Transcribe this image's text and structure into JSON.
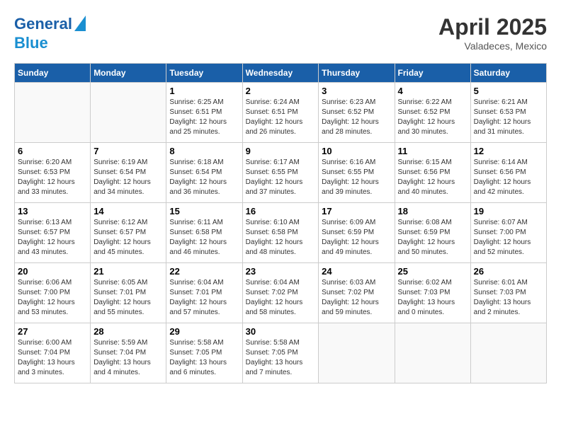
{
  "header": {
    "logo_line1": "General",
    "logo_line2": "Blue",
    "month": "April 2025",
    "location": "Valadeces, Mexico"
  },
  "weekdays": [
    "Sunday",
    "Monday",
    "Tuesday",
    "Wednesday",
    "Thursday",
    "Friday",
    "Saturday"
  ],
  "weeks": [
    [
      {
        "day": "",
        "info": ""
      },
      {
        "day": "",
        "info": ""
      },
      {
        "day": "1",
        "info": "Sunrise: 6:25 AM\nSunset: 6:51 PM\nDaylight: 12 hours\nand 25 minutes."
      },
      {
        "day": "2",
        "info": "Sunrise: 6:24 AM\nSunset: 6:51 PM\nDaylight: 12 hours\nand 26 minutes."
      },
      {
        "day": "3",
        "info": "Sunrise: 6:23 AM\nSunset: 6:52 PM\nDaylight: 12 hours\nand 28 minutes."
      },
      {
        "day": "4",
        "info": "Sunrise: 6:22 AM\nSunset: 6:52 PM\nDaylight: 12 hours\nand 30 minutes."
      },
      {
        "day": "5",
        "info": "Sunrise: 6:21 AM\nSunset: 6:53 PM\nDaylight: 12 hours\nand 31 minutes."
      }
    ],
    [
      {
        "day": "6",
        "info": "Sunrise: 6:20 AM\nSunset: 6:53 PM\nDaylight: 12 hours\nand 33 minutes."
      },
      {
        "day": "7",
        "info": "Sunrise: 6:19 AM\nSunset: 6:54 PM\nDaylight: 12 hours\nand 34 minutes."
      },
      {
        "day": "8",
        "info": "Sunrise: 6:18 AM\nSunset: 6:54 PM\nDaylight: 12 hours\nand 36 minutes."
      },
      {
        "day": "9",
        "info": "Sunrise: 6:17 AM\nSunset: 6:55 PM\nDaylight: 12 hours\nand 37 minutes."
      },
      {
        "day": "10",
        "info": "Sunrise: 6:16 AM\nSunset: 6:55 PM\nDaylight: 12 hours\nand 39 minutes."
      },
      {
        "day": "11",
        "info": "Sunrise: 6:15 AM\nSunset: 6:56 PM\nDaylight: 12 hours\nand 40 minutes."
      },
      {
        "day": "12",
        "info": "Sunrise: 6:14 AM\nSunset: 6:56 PM\nDaylight: 12 hours\nand 42 minutes."
      }
    ],
    [
      {
        "day": "13",
        "info": "Sunrise: 6:13 AM\nSunset: 6:57 PM\nDaylight: 12 hours\nand 43 minutes."
      },
      {
        "day": "14",
        "info": "Sunrise: 6:12 AM\nSunset: 6:57 PM\nDaylight: 12 hours\nand 45 minutes."
      },
      {
        "day": "15",
        "info": "Sunrise: 6:11 AM\nSunset: 6:58 PM\nDaylight: 12 hours\nand 46 minutes."
      },
      {
        "day": "16",
        "info": "Sunrise: 6:10 AM\nSunset: 6:58 PM\nDaylight: 12 hours\nand 48 minutes."
      },
      {
        "day": "17",
        "info": "Sunrise: 6:09 AM\nSunset: 6:59 PM\nDaylight: 12 hours\nand 49 minutes."
      },
      {
        "day": "18",
        "info": "Sunrise: 6:08 AM\nSunset: 6:59 PM\nDaylight: 12 hours\nand 50 minutes."
      },
      {
        "day": "19",
        "info": "Sunrise: 6:07 AM\nSunset: 7:00 PM\nDaylight: 12 hours\nand 52 minutes."
      }
    ],
    [
      {
        "day": "20",
        "info": "Sunrise: 6:06 AM\nSunset: 7:00 PM\nDaylight: 12 hours\nand 53 minutes."
      },
      {
        "day": "21",
        "info": "Sunrise: 6:05 AM\nSunset: 7:01 PM\nDaylight: 12 hours\nand 55 minutes."
      },
      {
        "day": "22",
        "info": "Sunrise: 6:04 AM\nSunset: 7:01 PM\nDaylight: 12 hours\nand 57 minutes."
      },
      {
        "day": "23",
        "info": "Sunrise: 6:04 AM\nSunset: 7:02 PM\nDaylight: 12 hours\nand 58 minutes."
      },
      {
        "day": "24",
        "info": "Sunrise: 6:03 AM\nSunset: 7:02 PM\nDaylight: 12 hours\nand 59 minutes."
      },
      {
        "day": "25",
        "info": "Sunrise: 6:02 AM\nSunset: 7:03 PM\nDaylight: 13 hours\nand 0 minutes."
      },
      {
        "day": "26",
        "info": "Sunrise: 6:01 AM\nSunset: 7:03 PM\nDaylight: 13 hours\nand 2 minutes."
      }
    ],
    [
      {
        "day": "27",
        "info": "Sunrise: 6:00 AM\nSunset: 7:04 PM\nDaylight: 13 hours\nand 3 minutes."
      },
      {
        "day": "28",
        "info": "Sunrise: 5:59 AM\nSunset: 7:04 PM\nDaylight: 13 hours\nand 4 minutes."
      },
      {
        "day": "29",
        "info": "Sunrise: 5:58 AM\nSunset: 7:05 PM\nDaylight: 13 hours\nand 6 minutes."
      },
      {
        "day": "30",
        "info": "Sunrise: 5:58 AM\nSunset: 7:05 PM\nDaylight: 13 hours\nand 7 minutes."
      },
      {
        "day": "",
        "info": ""
      },
      {
        "day": "",
        "info": ""
      },
      {
        "day": "",
        "info": ""
      }
    ]
  ]
}
